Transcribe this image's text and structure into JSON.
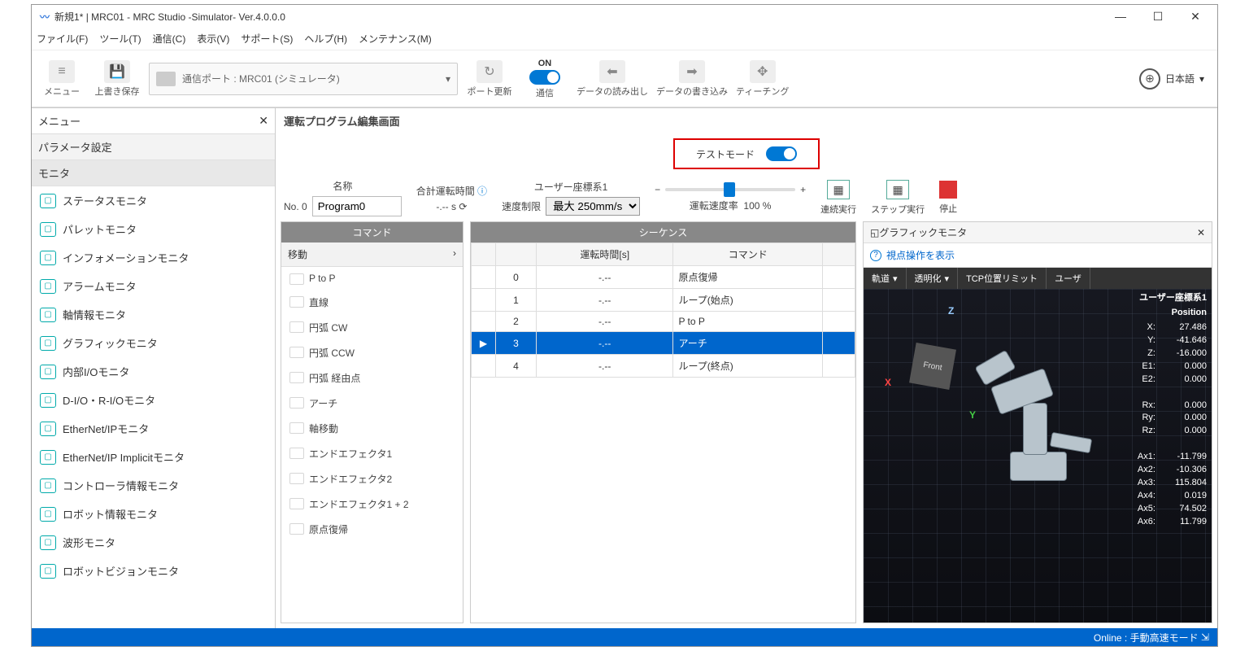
{
  "window": {
    "title": "新規1* | MRC01 - MRC Studio -Simulator- Ver.4.0.0.0"
  },
  "menu": {
    "file": "ファイル(F)",
    "tool": "ツール(T)",
    "comm": "通信(C)",
    "view": "表示(V)",
    "support": "サポート(S)",
    "help": "ヘルプ(H)",
    "maint": "メンテナンス(M)"
  },
  "toolbar": {
    "menu": "メニュー",
    "save": "上書き保存",
    "port": "通信ポート : MRC01 (シミュレータ)",
    "portupd": "ポート更新",
    "commOn": "ON",
    "comm": "通信",
    "read": "データの読み出し",
    "write": "データの書き込み",
    "teach": "ティーチング",
    "lang": "日本語"
  },
  "sidebar": {
    "title": "メニュー",
    "param": "パラメータ設定",
    "monitor": "モニタ",
    "items": [
      "ステータスモニタ",
      "パレットモニタ",
      "インフォメーションモニタ",
      "アラームモニタ",
      "軸情報モニタ",
      "グラフィックモニタ",
      "内部I/Oモニタ",
      "D-I/O・R-I/Oモニタ",
      "EtherNet/IPモニタ",
      "EtherNet/IP Implicitモニタ",
      "コントローラ情報モニタ",
      "ロボット情報モニタ",
      "波形モニタ",
      "ロボットビジョンモニタ"
    ]
  },
  "main": {
    "title": "運転プログラム編集画面",
    "test": "テストモード",
    "nameLbl": "名称",
    "noLbl": "No. 0",
    "name": "Program0",
    "totalTimeLbl": "合計運転時間",
    "totalTime": "-.-- s",
    "coordLbl": "ユーザー座標系1",
    "speedLbl": "速度制限",
    "speedVal": "最大 250mm/s",
    "rateLbl": "運転速度率",
    "rateVal": "100 %",
    "contRun": "連続実行",
    "stepRun": "ステップ実行",
    "stop": "停止"
  },
  "commands": {
    "title": "コマンド",
    "cat": "移動",
    "items": [
      "P to P",
      "直線",
      "円弧 CW",
      "円弧 CCW",
      "円弧 経由点",
      "アーチ",
      "軸移動",
      "エンドエフェクタ1",
      "エンドエフェクタ2",
      "エンドエフェクタ1 + 2",
      "原点復帰"
    ]
  },
  "sequence": {
    "title": "シーケンス",
    "colTime": "運転時間[s]",
    "colCmd": "コマンド",
    "rows": [
      {
        "n": "0",
        "t": "-.--",
        "c": "原点復帰"
      },
      {
        "n": "1",
        "t": "-.--",
        "c": "ループ(始点)"
      },
      {
        "n": "2",
        "t": "-.--",
        "c": "P to P"
      },
      {
        "n": "3",
        "t": "-.--",
        "c": "アーチ",
        "sel": true
      },
      {
        "n": "4",
        "t": "-.--",
        "c": "ループ(終点)"
      }
    ]
  },
  "gfx": {
    "title": "グラフィックモニタ",
    "help": "視点操作を表示",
    "tabs": [
      "軌道",
      "透明化",
      "TCP位置リミット",
      "ユーザ"
    ],
    "coord": "ユーザー座標系1",
    "posHdr": "Position",
    "vals": [
      [
        "X:",
        "27.486"
      ],
      [
        "Y:",
        "-41.646"
      ],
      [
        "Z:",
        "-16.000"
      ],
      [
        "E1:",
        "0.000"
      ],
      [
        "E2:",
        "0.000"
      ],
      [
        "",
        ""
      ],
      [
        "Rx:",
        "0.000"
      ],
      [
        "Ry:",
        "0.000"
      ],
      [
        "Rz:",
        "0.000"
      ],
      [
        "",
        ""
      ],
      [
        "Ax1:",
        "-11.799"
      ],
      [
        "Ax2:",
        "-10.306"
      ],
      [
        "Ax3:",
        "115.804"
      ],
      [
        "Ax4:",
        "0.019"
      ],
      [
        "Ax5:",
        "74.502"
      ],
      [
        "Ax6:",
        "11.799"
      ]
    ],
    "cube": "Front",
    "axX": "X",
    "axY": "Y",
    "axZ": "Z"
  },
  "status": "Online : 手動高速モード"
}
